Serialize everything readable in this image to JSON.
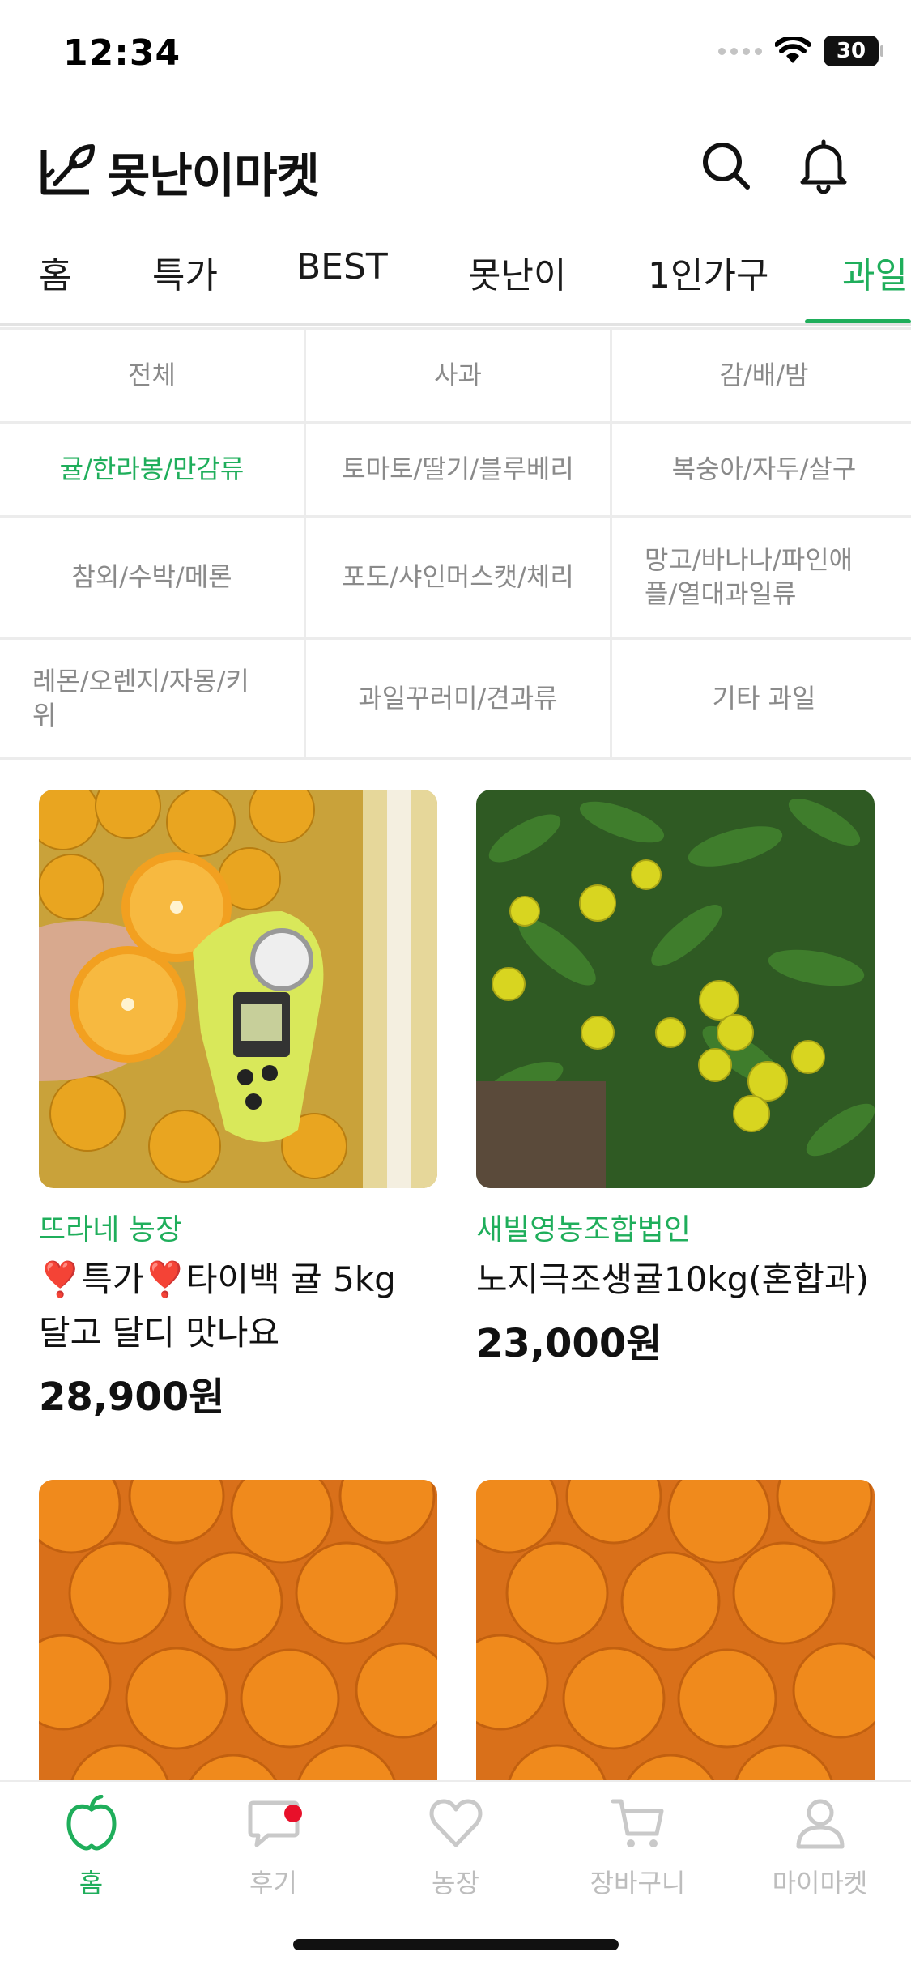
{
  "status_bar": {
    "time": "12:34",
    "battery": "30"
  },
  "header": {
    "app_name": "못난이마켓"
  },
  "top_tabs": [
    {
      "label": "홈",
      "active": false
    },
    {
      "label": "특가",
      "active": false
    },
    {
      "label": "BEST",
      "active": false
    },
    {
      "label": "못난이",
      "active": false
    },
    {
      "label": "1인가구",
      "active": false
    },
    {
      "label": "과일",
      "active": true
    }
  ],
  "categories": [
    "전체",
    "사과",
    "감/배/밤",
    "귤/한라봉/만감류",
    "토마토/딸기/블루베리",
    "복숭아/자두/살구",
    "참외/수박/메론",
    "포도/샤인머스캣/체리",
    "망고/바나나/파인애플/열대과일류",
    "레몬/오렌지/자몽/키위",
    "과일꾸러미/견과류",
    "기타 과일"
  ],
  "active_category": "귤/한라봉/만감류",
  "products": [
    {
      "farm": "뜨라네 농장",
      "title": "❣️특가❣️타이백 귤 5kg 달고 달디 맛나요",
      "price": "28,900원"
    },
    {
      "farm": "새빌영농조합법인",
      "title": "노지극조생귤10kg(혼합과)",
      "price": "23,000원"
    },
    {
      "farm": "",
      "title": "",
      "price": ""
    },
    {
      "farm": "",
      "title": "",
      "price": ""
    }
  ],
  "bottom_nav": [
    {
      "label": "홈",
      "icon": "apple-icon",
      "active": true
    },
    {
      "label": "후기",
      "icon": "chat-icon",
      "active": false
    },
    {
      "label": "농장",
      "icon": "heart-icon",
      "active": false
    },
    {
      "label": "장바구니",
      "icon": "cart-icon",
      "active": false
    },
    {
      "label": "마이마켓",
      "icon": "person-icon",
      "active": false
    }
  ],
  "colors": {
    "accent": "#1fae5b",
    "badge": "#e8102a"
  }
}
